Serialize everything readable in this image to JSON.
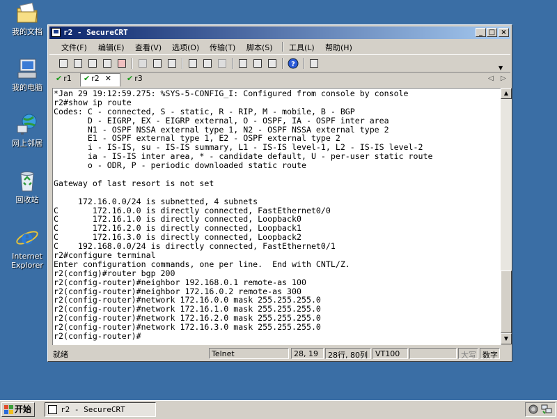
{
  "desktop": {
    "icons": [
      {
        "label": "我的文档",
        "icon": "my-documents-icon"
      },
      {
        "label": "我的电脑",
        "icon": "my-computer-icon"
      },
      {
        "label": "网上邻居",
        "icon": "network-places-icon"
      },
      {
        "label": "回收站",
        "icon": "recycle-bin-icon"
      },
      {
        "label": "Internet Explorer",
        "icon": "internet-explorer-icon"
      }
    ]
  },
  "window": {
    "title": "r2 - SecureCRT",
    "menu": [
      "文件(F)",
      "编辑(E)",
      "查看(V)",
      "选项(O)",
      "传输(T)",
      "脚本(S)",
      "工具(L)",
      "帮助(H)"
    ],
    "tabs": [
      {
        "label": "r1",
        "active": false
      },
      {
        "label": "r2",
        "active": true
      },
      {
        "label": "r3",
        "active": false
      }
    ],
    "terminal_lines": [
      "*Jan 29 19:12:59.275: %SYS-5-CONFIG_I: Configured from console by console",
      "r2#show ip route",
      "Codes: C - connected, S - static, R - RIP, M - mobile, B - BGP",
      "       D - EIGRP, EX - EIGRP external, O - OSPF, IA - OSPF inter area",
      "       N1 - OSPF NSSA external type 1, N2 - OSPF NSSA external type 2",
      "       E1 - OSPF external type 1, E2 - OSPF external type 2",
      "       i - IS-IS, su - IS-IS summary, L1 - IS-IS level-1, L2 - IS-IS level-2",
      "       ia - IS-IS inter area, * - candidate default, U - per-user static route",
      "       o - ODR, P - periodic downloaded static route",
      "",
      "Gateway of last resort is not set",
      "",
      "     172.16.0.0/24 is subnetted, 4 subnets",
      "C       172.16.0.0 is directly connected, FastEthernet0/0",
      "C       172.16.1.0 is directly connected, Loopback0",
      "C       172.16.2.0 is directly connected, Loopback1",
      "C       172.16.3.0 is directly connected, Loopback2",
      "C    192.168.0.0/24 is directly connected, FastEthernet0/1",
      "r2#configure terminal",
      "Enter configuration commands, one per line.  End with CNTL/Z.",
      "r2(config)#router bgp 200",
      "r2(config-router)#neighbor 192.168.0.1 remote-as 100",
      "r2(config-router)#neighbor 172.16.0.2 remote-as 300",
      "r2(config-router)#network 172.16.0.0 mask 255.255.255.0",
      "r2(config-router)#network 172.16.1.0 mask 255.255.255.0",
      "r2(config-router)#network 172.16.2.0 mask 255.255.255.0",
      "r2(config-router)#network 172.16.3.0 mask 255.255.255.0",
      "r2(config-router)#"
    ],
    "status": {
      "ready": "就绪",
      "protocol": "Telnet",
      "cursor": "28, 19",
      "size": "28行, 80列",
      "emulation": "VT100",
      "caps": "大写",
      "num": "数字"
    }
  },
  "taskbar": {
    "start_label": "开始",
    "task_title": "r2 - SecureCRT"
  },
  "colors": {
    "desktop": "#3a6ea5",
    "titlebar_start": "#0a246a",
    "titlebar_end": "#a6caf0",
    "chrome": "#d4d0c8",
    "tab_check": "#1a9a1a"
  }
}
